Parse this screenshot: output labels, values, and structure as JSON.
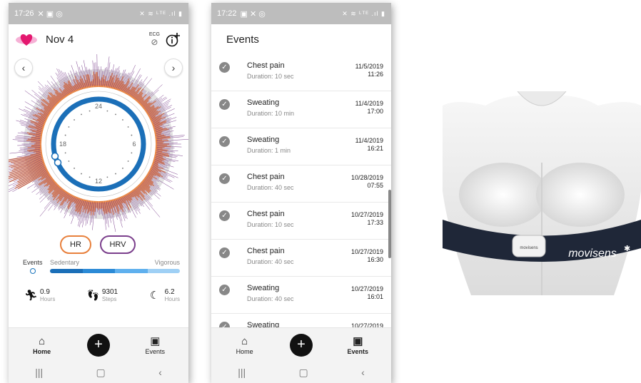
{
  "phone1": {
    "status_time": "17:26",
    "status_right": "✕ ≋ ᴸᵀᴱ .ıl ▮",
    "date": "Nov 4",
    "ecg_label": "ECG",
    "clock_labels": {
      "top": "24",
      "right": "6",
      "bottom": "12",
      "left": "18"
    },
    "buttons": {
      "hr": "HR",
      "hrv": "HRV"
    },
    "legend": {
      "events": "Events",
      "sedentary": "Sedentary",
      "vigorous": "Vigorous"
    },
    "activity_colors": [
      "#1b6fb8",
      "#2b8ad6",
      "#5fb0ee",
      "#9fd0f5"
    ],
    "stats": [
      {
        "icon": "running-icon",
        "value": "0.9",
        "unit": "Hours"
      },
      {
        "icon": "footsteps-icon",
        "value": "9301",
        "unit": "Steps"
      },
      {
        "icon": "moon-icon",
        "value": "6.2",
        "unit": "Hours"
      }
    ],
    "nav": {
      "home": "Home",
      "events": "Events"
    }
  },
  "phone2": {
    "status_time": "17:22",
    "status_right": "✕ ≋ ᴸᵀᴱ .ıl ▮",
    "title": "Events",
    "events": [
      {
        "title": "Chest pain",
        "duration": "Duration: 10 sec",
        "date": "11/5/2019",
        "time": "11:26"
      },
      {
        "title": "Sweating",
        "duration": "Duration: 10 min",
        "date": "11/4/2019",
        "time": "17:00"
      },
      {
        "title": "Sweating",
        "duration": "Duration: 1 min",
        "date": "11/4/2019",
        "time": "16:21"
      },
      {
        "title": "Chest pain",
        "duration": "Duration: 40 sec",
        "date": "10/28/2019",
        "time": "07:55"
      },
      {
        "title": "Chest pain",
        "duration": "Duration: 10 sec",
        "date": "10/27/2019",
        "time": "17:33"
      },
      {
        "title": "Chest pain",
        "duration": "Duration: 40 sec",
        "date": "10/27/2019",
        "time": "16:30"
      },
      {
        "title": "Sweating",
        "duration": "Duration: 40 sec",
        "date": "10/27/2019",
        "time": "16:01"
      },
      {
        "title": "Sweating",
        "duration": "",
        "date": "10/27/2019",
        "time": ""
      }
    ],
    "nav": {
      "home": "Home",
      "events": "Events"
    }
  },
  "photo": {
    "sensor_text": "movisens",
    "strap_text": "movisens"
  },
  "colors": {
    "hr": "#e8803c",
    "hrv": "#7b3f8c",
    "ring_blue": "#1b6fb8",
    "ring_gray": "#dedede"
  }
}
